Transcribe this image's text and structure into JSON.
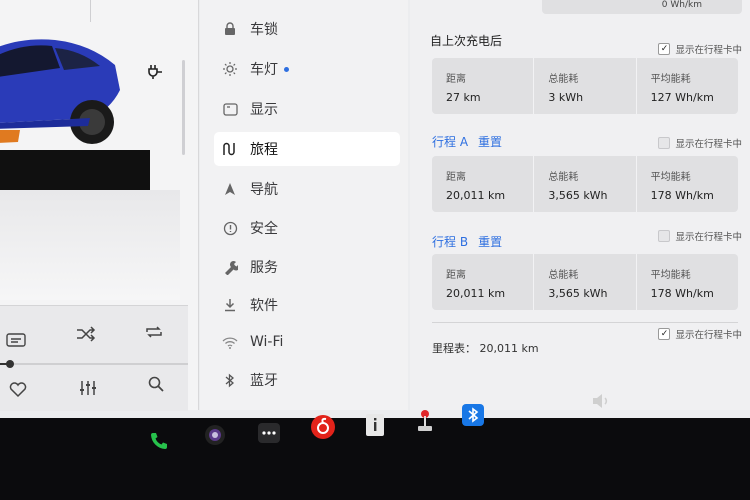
{
  "menu": {
    "items": [
      {
        "label": "车锁",
        "icon": "lock-icon"
      },
      {
        "label": "车灯",
        "icon": "light-icon"
      },
      {
        "label": "显示",
        "icon": "display-icon"
      },
      {
        "label": "旅程",
        "icon": "trip-icon"
      },
      {
        "label": "导航",
        "icon": "navigation-icon"
      },
      {
        "label": "安全",
        "icon": "safety-icon"
      },
      {
        "label": "服务",
        "icon": "wrench-icon"
      },
      {
        "label": "软件",
        "icon": "download-icon"
      },
      {
        "label": "Wi-Fi",
        "icon": "wifi-icon"
      },
      {
        "label": "蓝牙",
        "icon": "bluetooth-icon"
      }
    ]
  },
  "top": {
    "partial_value": "0 Wh/km"
  },
  "since_charge": {
    "title": "自上次充电后",
    "show_label": "显示在行程卡中",
    "show_checked": true,
    "distance_label": "距离",
    "distance": "27 km",
    "energy_label": "总能耗",
    "energy": "3 kWh",
    "avg_label": "平均能耗",
    "avg": "127 Wh/km"
  },
  "trip_a": {
    "title": "行程 A",
    "reset": "重置",
    "show_label": "显示在行程卡中",
    "show_checked": false,
    "distance_label": "距离",
    "distance": "20,011 km",
    "energy_label": "总能耗",
    "energy": "3,565 kWh",
    "avg_label": "平均能耗",
    "avg": "178 Wh/km"
  },
  "trip_b": {
    "title": "行程 B",
    "reset": "重置",
    "show_label": "显示在行程卡中",
    "show_checked": false,
    "distance_label": "距离",
    "distance": "20,011 km",
    "energy_label": "总能耗",
    "energy": "3,565 kWh",
    "avg_label": "平均能耗",
    "avg": "178 Wh/km"
  },
  "odometer": {
    "label": "里程表：",
    "value": "20,011 km",
    "show_label": "显示在行程卡中",
    "show_checked": true
  },
  "colors": {
    "accent": "#2e6fe0",
    "car_blue": "#2a3bb8"
  }
}
